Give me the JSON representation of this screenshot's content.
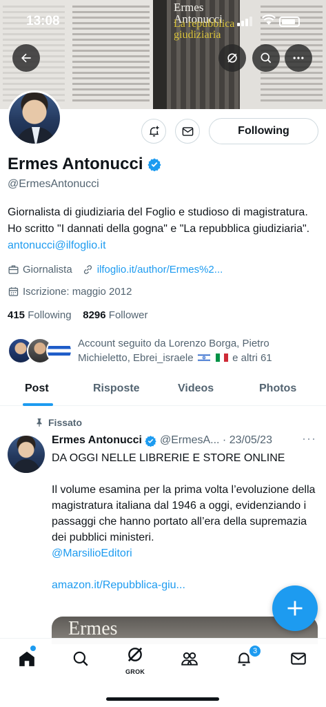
{
  "status_bar": {
    "time": "13:08"
  },
  "banner": {
    "book_author": "Ermes Antonucci",
    "book_title": "La repubblica giudiziaria"
  },
  "header": {
    "back": "back-arrow-icon",
    "actions": [
      "grok-icon",
      "search-icon",
      "more-icon"
    ]
  },
  "profile": {
    "name": "Ermes Antonucci",
    "handle": "@ErmesAntonucci",
    "follow_state_label": "Following",
    "bio_text": "Giornalista di giudiziaria del Foglio e studioso di magistratura. Ho scritto \"I dannati della gogna\" e \"La repubblica giudiziaria\".",
    "bio_email": "antonucci@ilfoglio.it",
    "profession": "Giornalista",
    "website": "ilfoglio.it/author/Ermes%2...",
    "joined": "Iscrizione: maggio 2012",
    "following_count": "415",
    "following_label": "Following",
    "followers_count": "8296",
    "followers_label": "Follower",
    "followed_by_text": "Account seguito da Lorenzo Borga, Pietro Michieletto, Ebrei_israele",
    "followed_by_more": "e altri 61"
  },
  "tabs": [
    {
      "label": "Post"
    },
    {
      "label": "Risposte"
    },
    {
      "label": "Videos"
    },
    {
      "label": "Photos"
    }
  ],
  "pinned_tweet": {
    "pinned_label": "Fissato",
    "author": "Ermes Antonucci",
    "handle_date": "@ErmesA... · 23/05/23",
    "more": "···",
    "lines": [
      "DA OGGI NELLE LIBRERIE E STORE ONLINE",
      "",
      "Il volume esamina per la prima volta l’evoluzione della magistratura italiana dal 1946 a oggi, evidenziando i passaggi che hanno portato all’era della supremazia dei pubblici ministeri."
    ],
    "mention": "@MarsilioEditori",
    "link": "amazon.it/Repubblica-giu...",
    "media_text": "Ermes"
  },
  "bottom_nav": {
    "grok_label": "GROK",
    "notifications_badge": "3"
  },
  "colors": {
    "accent": "#1d9bf0",
    "text_primary": "#0f1419",
    "text_secondary": "#536471"
  }
}
